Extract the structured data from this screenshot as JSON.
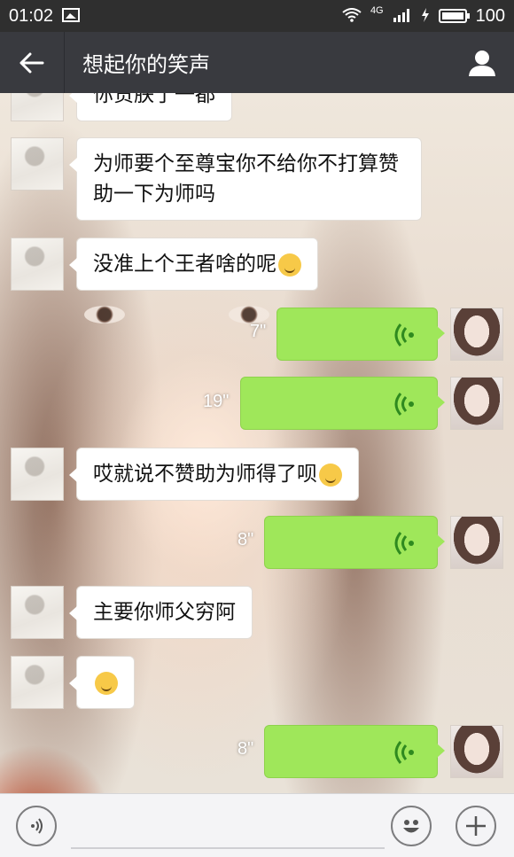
{
  "status_bar": {
    "time": "01:02",
    "network": "4G",
    "battery": "100"
  },
  "header": {
    "title": "想起你的笑声"
  },
  "messages": [
    {
      "side": "left",
      "type": "text",
      "text": "你贯朕了一都"
    },
    {
      "side": "left",
      "type": "text",
      "text": "为师要个至尊宝你不给你不打算赞助一下为师吗"
    },
    {
      "side": "left",
      "type": "text",
      "text": "没准上个王者啥的呢",
      "emoji": "thinking-emoji"
    },
    {
      "side": "right",
      "type": "voice",
      "duration": "7\""
    },
    {
      "side": "right",
      "type": "voice",
      "duration": "19\""
    },
    {
      "side": "left",
      "type": "text",
      "text": "哎就说不赞助为师得了呗",
      "emoji": "crying-laugh-emoji"
    },
    {
      "side": "right",
      "type": "voice",
      "duration": "8\""
    },
    {
      "side": "left",
      "type": "text",
      "text": "主要你师父穷阿"
    },
    {
      "side": "left",
      "type": "text",
      "text": "",
      "emoji": "crying-emoji"
    },
    {
      "side": "right",
      "type": "voice",
      "duration": "8\""
    }
  ],
  "colors": {
    "title_bar": "#393a3f",
    "voice_bubble": "#9fe75a",
    "voice_icon": "#2f8a1f"
  }
}
